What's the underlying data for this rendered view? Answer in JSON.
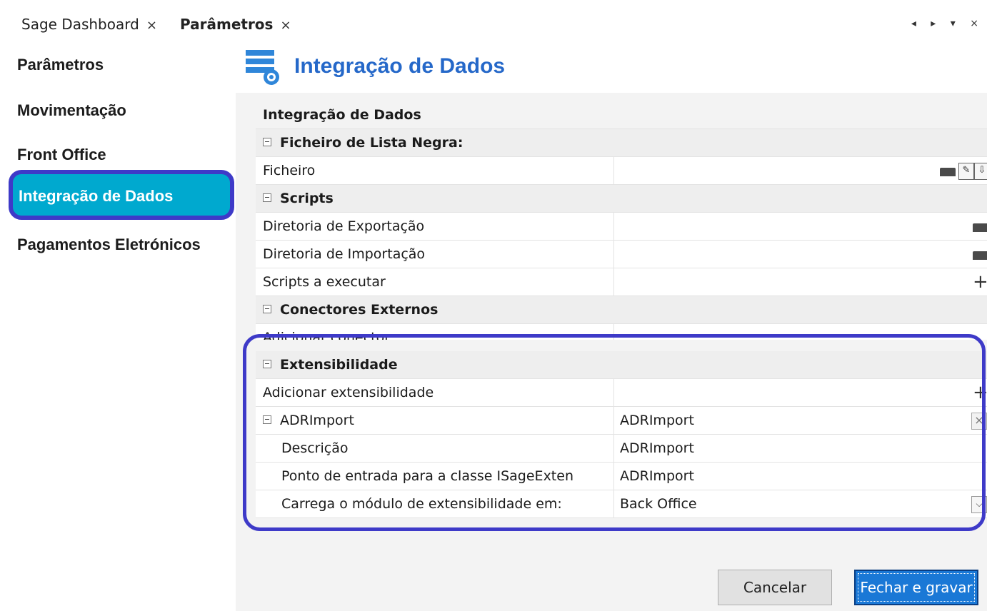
{
  "tabs": [
    {
      "label": "Sage Dashboard",
      "close": "×"
    },
    {
      "label": "Parâmetros",
      "close": "×"
    }
  ],
  "window_controls": "◂ ▸ ▾ ×",
  "sidebar": {
    "items": [
      {
        "label": "Parâmetros"
      },
      {
        "label": "Movimentação"
      },
      {
        "label": "Front Office"
      },
      {
        "label": "Integração de Dados"
      },
      {
        "label": "Pagamentos Eletrónicos"
      }
    ],
    "active": "Integração de Dados"
  },
  "header": {
    "title": "Integração de Dados",
    "icon": "server-gear-icon"
  },
  "grid": {
    "title": "Integração de Dados",
    "categories": {
      "lista_negra": "Ficheiro de Lista Negra:",
      "scripts": "Scripts",
      "conectores": "Conectores Externos",
      "extensibilidade": "Extensibilidade"
    },
    "rows": {
      "ficheiro": {
        "label": "Ficheiro",
        "value": ""
      },
      "dir_export": {
        "label": "Diretoria de Exportação",
        "value": ""
      },
      "dir_import": {
        "label": "Diretoria de Importação",
        "value": ""
      },
      "scripts_exec": {
        "label": "Scripts a executar",
        "value": ""
      },
      "add_conector": {
        "label": "Adicionar conector",
        "value": ""
      },
      "add_ext": {
        "label": "Adicionar extensibilidade",
        "value": ""
      },
      "adrimport": {
        "label": "ADRImport",
        "value": "ADRImport"
      },
      "descricao": {
        "label": "Descrição",
        "value": "ADRImport"
      },
      "ponto_entrada": {
        "label": "Ponto de entrada para a classe ISageExten",
        "value": "ADRImport"
      },
      "carrega": {
        "label": "Carrega o módulo de extensibilidade em:",
        "value": "Back Office"
      }
    }
  },
  "buttons": {
    "cancel": "Cancelar",
    "save": "Fechar e gravar"
  },
  "colors": {
    "accent": "#2568c9",
    "active_nav": "#00a9cf",
    "highlight": "#3e3ac8",
    "primary_button": "#1a78d6"
  }
}
